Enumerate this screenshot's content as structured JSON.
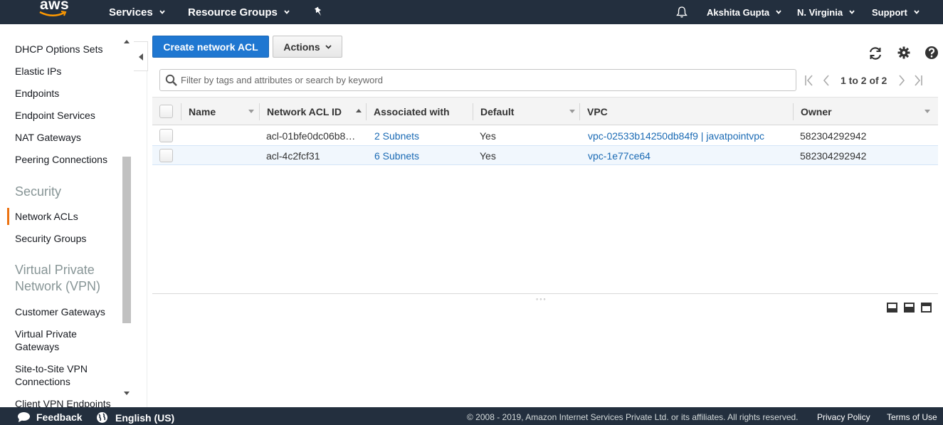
{
  "topnav": {
    "logo_text": "aws",
    "services": "Services",
    "resource_groups": "Resource Groups",
    "user": "Akshita Gupta",
    "region": "N. Virginia",
    "support": "Support"
  },
  "sidebar": {
    "items_top": [
      "DHCP Options Sets",
      "Elastic IPs",
      "Endpoints",
      "Endpoint Services",
      "NAT Gateways",
      "Peering Connections"
    ],
    "security_heading": "Security",
    "security_items": [
      "Network ACLs",
      "Security Groups"
    ],
    "vpn_heading_line1": "Virtual Private",
    "vpn_heading_line2": "Network (VPN)",
    "vpn_items": [
      "Customer Gateways",
      "Virtual Private",
      "Gateways",
      "Site-to-Site VPN",
      "Connections",
      "Client VPN Endpoints"
    ],
    "active_item": "Network ACLs"
  },
  "toolbar": {
    "create_label": "Create network ACL",
    "actions_label": "Actions"
  },
  "search": {
    "placeholder": "Filter by tags and attributes or search by keyword"
  },
  "pager": {
    "text": "1 to 2 of 2"
  },
  "table": {
    "columns": [
      "Name",
      "Network ACL ID",
      "Associated with",
      "Default",
      "VPC",
      "Owner"
    ],
    "rows": [
      {
        "name": "",
        "acl_id": "acl-01bfe0dc06b8…",
        "associated": "2 Subnets",
        "default": "Yes",
        "vpc": "vpc-02533b14250db84f9 | javatpointvpc",
        "owner": "582304292942"
      },
      {
        "name": "",
        "acl_id": "acl-4c2fcf31",
        "associated": "6 Subnets",
        "default": "Yes",
        "vpc": "vpc-1e77ce64",
        "owner": "582304292942"
      }
    ]
  },
  "footer": {
    "feedback": "Feedback",
    "language": "English (US)",
    "copyright": "© 2008 - 2019, Amazon Internet Services Private Ltd. or its affiliates. All rights reserved.",
    "privacy": "Privacy Policy",
    "terms": "Terms of Use"
  },
  "colors": {
    "nav_bg": "#232f3e",
    "primary": "#1f77d1",
    "link": "#1a6ab4",
    "active_accent": "#ec7211"
  }
}
